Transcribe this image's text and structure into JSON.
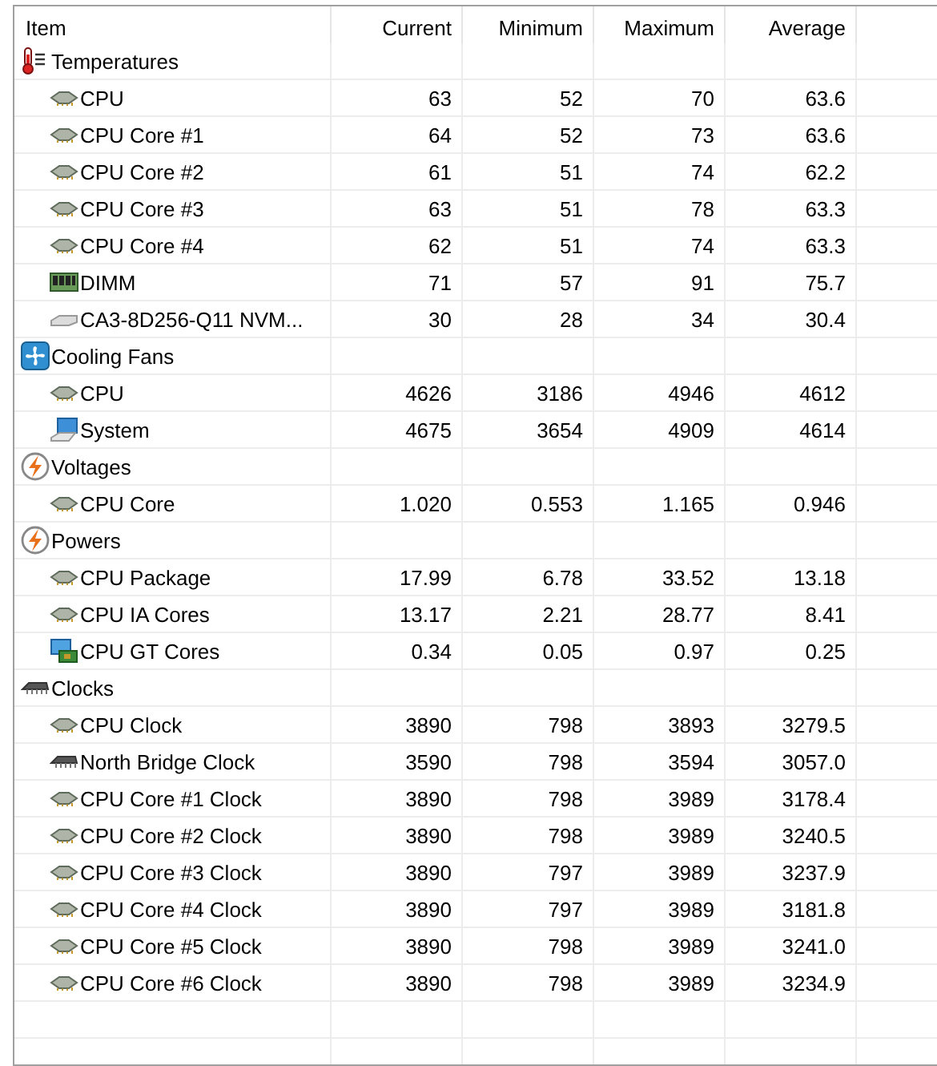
{
  "table": {
    "columns": [
      "Item",
      "Current",
      "Minimum",
      "Maximum",
      "Average"
    ],
    "groups": [
      {
        "label": "Temperatures",
        "kind": "thermometer",
        "rows": [
          {
            "label": "CPU",
            "kind": "chip",
            "values": [
              "63",
              "52",
              "70",
              "63.6"
            ]
          },
          {
            "label": "CPU Core #1",
            "kind": "chip",
            "values": [
              "64",
              "52",
              "73",
              "63.6"
            ]
          },
          {
            "label": "CPU Core #2",
            "kind": "chip",
            "values": [
              "61",
              "51",
              "74",
              "62.2"
            ]
          },
          {
            "label": "CPU Core #3",
            "kind": "chip",
            "values": [
              "63",
              "51",
              "78",
              "63.3"
            ]
          },
          {
            "label": "CPU Core #4",
            "kind": "chip",
            "values": [
              "62",
              "51",
              "74",
              "63.3"
            ]
          },
          {
            "label": "DIMM",
            "kind": "memory",
            "values": [
              "71",
              "57",
              "91",
              "75.7"
            ]
          },
          {
            "label": "CA3-8D256-Q11 NVM...",
            "kind": "drive",
            "values": [
              "30",
              "28",
              "34",
              "30.4"
            ]
          }
        ]
      },
      {
        "label": "Cooling Fans",
        "kind": "fan",
        "rows": [
          {
            "label": "CPU",
            "kind": "chip",
            "values": [
              "4626",
              "3186",
              "4946",
              "4612"
            ]
          },
          {
            "label": "System",
            "kind": "computer",
            "values": [
              "4675",
              "3654",
              "4909",
              "4614"
            ]
          }
        ]
      },
      {
        "label": "Voltages",
        "kind": "bolt",
        "rows": [
          {
            "label": "CPU Core",
            "kind": "chip",
            "values": [
              "1.020",
              "0.553",
              "1.165",
              "0.946"
            ]
          }
        ]
      },
      {
        "label": "Powers",
        "kind": "bolt",
        "rows": [
          {
            "label": "CPU Package",
            "kind": "chip",
            "values": [
              "17.99",
              "6.78",
              "33.52",
              "13.18"
            ]
          },
          {
            "label": "CPU IA Cores",
            "kind": "chip",
            "values": [
              "13.17",
              "2.21",
              "28.77",
              "8.41"
            ]
          },
          {
            "label": "CPU GT Cores",
            "kind": "gpu",
            "values": [
              "0.34",
              "0.05",
              "0.97",
              "0.25"
            ]
          }
        ]
      },
      {
        "label": "Clocks",
        "kind": "darkchip",
        "rows": [
          {
            "label": "CPU Clock",
            "kind": "chip",
            "values": [
              "3890",
              "798",
              "3893",
              "3279.5"
            ]
          },
          {
            "label": "North Bridge Clock",
            "kind": "darkchip",
            "values": [
              "3590",
              "798",
              "3594",
              "3057.0"
            ]
          },
          {
            "label": "CPU Core #1 Clock",
            "kind": "chip",
            "values": [
              "3890",
              "798",
              "3989",
              "3178.4"
            ]
          },
          {
            "label": "CPU Core #2 Clock",
            "kind": "chip",
            "values": [
              "3890",
              "798",
              "3989",
              "3240.5"
            ]
          },
          {
            "label": "CPU Core #3 Clock",
            "kind": "chip",
            "values": [
              "3890",
              "797",
              "3989",
              "3237.9"
            ]
          },
          {
            "label": "CPU Core #4 Clock",
            "kind": "chip",
            "values": [
              "3890",
              "797",
              "3989",
              "3181.8"
            ]
          },
          {
            "label": "CPU Core #5 Clock",
            "kind": "chip",
            "values": [
              "3890",
              "798",
              "3989",
              "3241.0"
            ]
          },
          {
            "label": "CPU Core #6 Clock",
            "kind": "chip",
            "values": [
              "3890",
              "798",
              "3989",
              "3234.9"
            ]
          }
        ]
      }
    ]
  }
}
